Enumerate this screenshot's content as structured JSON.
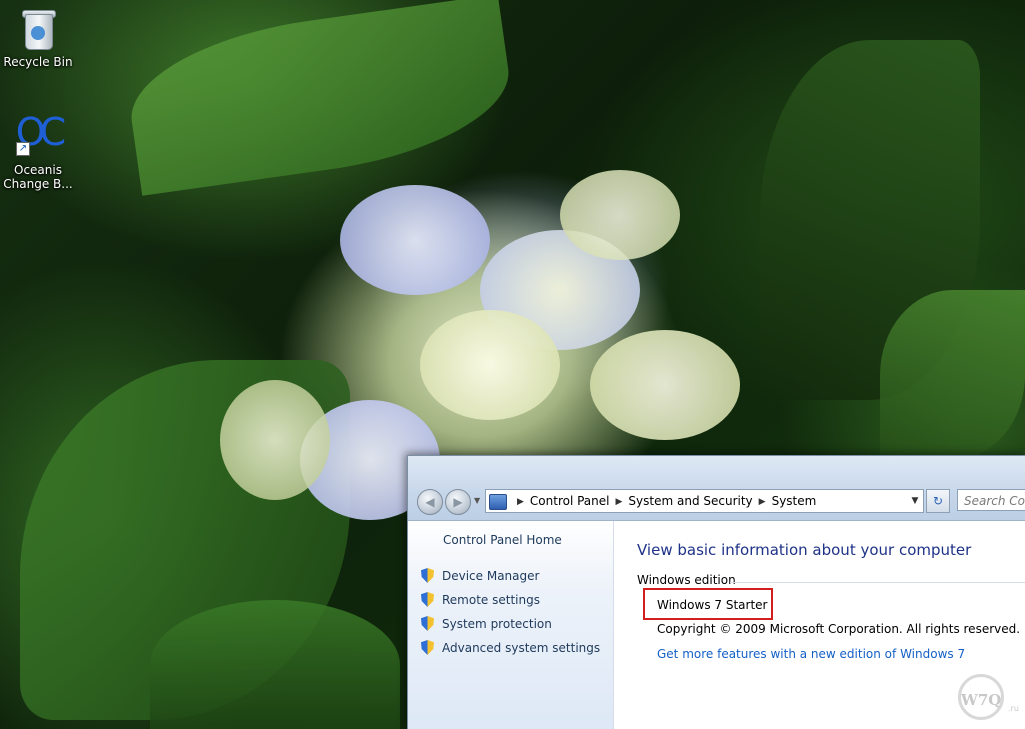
{
  "desktop": {
    "icons": [
      {
        "label": "Recycle Bin",
        "icon": "recycle-bin-icon"
      },
      {
        "label": "Oceanis Change B...",
        "icon": "oceanis-icon",
        "glyph": "OC"
      }
    ]
  },
  "window": {
    "navigation": {
      "back_glyph": "◀",
      "forward_glyph": "▶",
      "dropdown_glyph": "▼"
    },
    "address": {
      "separator": "▶",
      "crumbs": [
        "Control Panel",
        "System and Security",
        "System"
      ],
      "dropdown_glyph": "▼",
      "refresh_glyph": "↻"
    },
    "search": {
      "placeholder": "Search Con"
    },
    "sidebar": {
      "home": "Control Panel Home",
      "items": [
        {
          "label": "Device Manager"
        },
        {
          "label": "Remote settings"
        },
        {
          "label": "System protection"
        },
        {
          "label": "Advanced system settings"
        }
      ]
    },
    "content": {
      "title": "View basic information about your computer",
      "section": "Windows edition",
      "edition": "Windows 7 Starter",
      "copyright": "Copyright © 2009 Microsoft Corporation.  All rights reserved.",
      "link": "Get more features with a new edition of Windows 7"
    }
  },
  "watermark": {
    "text": "W7Q",
    "suffix": ".ru"
  },
  "colors": {
    "title_blue": "#1e3287",
    "link_blue": "#1460c7",
    "highlight_red": "#d21e1e",
    "nav_text": "#1e395b"
  }
}
